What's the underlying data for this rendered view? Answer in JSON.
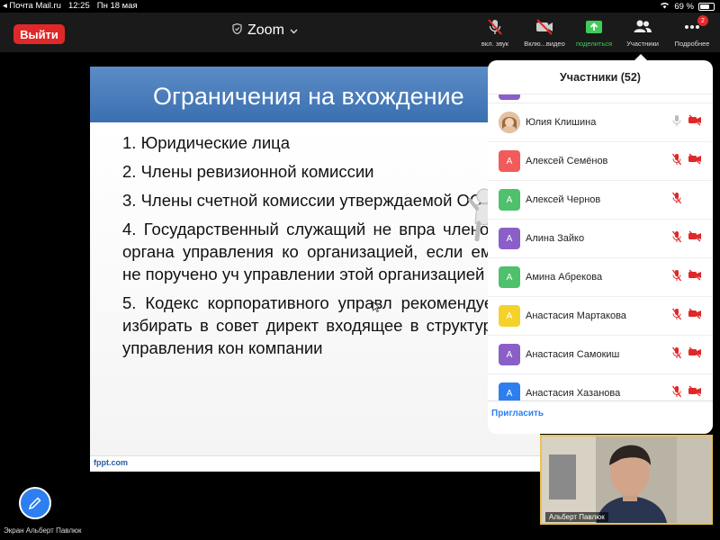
{
  "status_bar": {
    "back_app": "Почта Mail.ru",
    "time": "12:25",
    "date": "Пн 18 мая",
    "battery": "69 %",
    "battery_level": 0.69
  },
  "toolbar": {
    "leave_label": "Выйти",
    "app_title": "Zoom",
    "tools": [
      {
        "label": "вкл. звук",
        "icon": "mic-muted-icon"
      },
      {
        "label": "Вклю...видео",
        "icon": "video-off-icon"
      },
      {
        "label": "поделиться",
        "icon": "share-screen-icon"
      },
      {
        "label": "Участники",
        "icon": "participants-icon"
      },
      {
        "label": "Подробнее",
        "icon": "more-icon",
        "badge": "2"
      }
    ]
  },
  "slide": {
    "title": "Ограничения на вхождение",
    "items": [
      "1. Юридические лица",
      "2. Члены ревизионной комиссии",
      "3. Члены счетной комиссии утверждаемой ОСА",
      "4. Государственный служащий не впра членом органа управления ко организацией, если ему не поручено уч управлении этой организацией",
      "5. Кодекс корпоративного управл рекомендует избирать в совет директ входящее в структуру управления кон компании"
    ],
    "footer": "fppt.com"
  },
  "participants_panel": {
    "title": "Участники (52)",
    "invite_label": "Пригласить",
    "participants": [
      {
        "name": "Юлия Клишина",
        "initial": "",
        "color": "#d9a57a",
        "mic_muted": false,
        "video_off": true
      },
      {
        "name": "Алексей Семёнов",
        "initial": "А",
        "color": "#f25b5b",
        "mic_muted": true,
        "video_off": true
      },
      {
        "name": "Алексей Чернов",
        "initial": "А",
        "color": "#4fc06b",
        "mic_muted": true,
        "video_off": false
      },
      {
        "name": "Алина Зайко",
        "initial": "А",
        "color": "#8a5fc8",
        "mic_muted": true,
        "video_off": true
      },
      {
        "name": "Амина Абрекова",
        "initial": "А",
        "color": "#4fc06b",
        "mic_muted": true,
        "video_off": true
      },
      {
        "name": "Анастасия Мартакова",
        "initial": "А",
        "color": "#f5d22a",
        "mic_muted": true,
        "video_off": true
      },
      {
        "name": "Анастасия Самокиш",
        "initial": "А",
        "color": "#8a5fc8",
        "mic_muted": true,
        "video_off": true
      },
      {
        "name": "Анастасия Хазанова",
        "initial": "А",
        "color": "#2d7ff0",
        "mic_muted": true,
        "video_off": true
      }
    ]
  },
  "video_tile": {
    "name": "Альберт Павлюк"
  },
  "share_control": {
    "label": "Экран Альберт Павлюк",
    "icon": "pencil-icon"
  },
  "colors": {
    "leave": "#e02828",
    "accent": "#2d7ff0",
    "muted_red": "#e02828",
    "share_green": "#3fcc5a",
    "active_speaker": "#e8c24a"
  }
}
